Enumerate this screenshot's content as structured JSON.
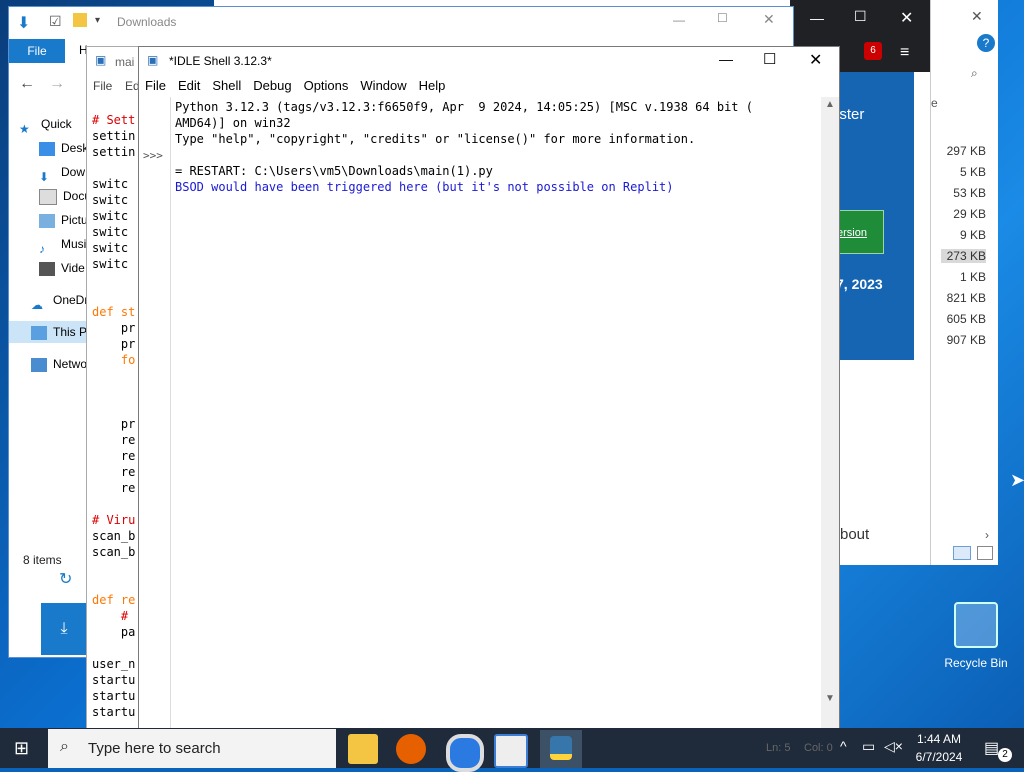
{
  "explorer": {
    "title": "Downloads",
    "file_tab": "File",
    "home_tab": "H",
    "edit_tab": "Ed",
    "nav": [
      {
        "label": "Quick"
      },
      {
        "label": "Desk"
      },
      {
        "label": "Dow"
      },
      {
        "label": "Docu"
      },
      {
        "label": "Pictu"
      },
      {
        "label": "Musi"
      },
      {
        "label": "Vide"
      },
      {
        "label": "OneDr"
      },
      {
        "label": "This P"
      },
      {
        "label": "Netwo"
      }
    ],
    "status": "8 items",
    "sizes": [
      "297 KB",
      "5 KB",
      "53 KB",
      "29 KB",
      "9 KB",
      "273 KB",
      "1 KB",
      "821 KB",
      "605 KB",
      "907 KB"
    ]
  },
  "editor": {
    "title": "mai",
    "menu": [
      "File",
      "Ed"
    ],
    "lines": [
      "# Sett",
      "settin",
      "settin",
      "",
      "switc",
      "switc",
      "switc",
      "switc",
      "switc",
      "switc",
      "",
      "",
      "def st",
      "    pr",
      "    pr",
      "    fo",
      "",
      "",
      "",
      "    pr",
      "    re",
      "    re",
      "    re",
      "    re",
      "",
      "# Viru",
      "scan_b",
      "scan_b",
      "",
      "",
      "def re",
      "    #",
      "    pa",
      "",
      "user_n",
      "startu",
      "startu",
      "startu"
    ],
    "status_line": "Ln: 5",
    "status_col": "Col: 0"
  },
  "browser": {
    "badge": "6",
    "link_text": "ister",
    "button_text": "ersion",
    "date_text": "7, 2023",
    "about_text": "bout",
    "right_char": "e"
  },
  "idle": {
    "title": "*IDLE Shell 3.12.3*",
    "menu": [
      "File",
      "Edit",
      "Shell",
      "Debug",
      "Options",
      "Window",
      "Help"
    ],
    "prompt": ">>>",
    "lines": [
      {
        "text": "Python 3.12.3 (tags/v3.12.3:f6650f9, Apr  9 2024, 14:05:25) [MSC v.1938 64 bit (",
        "color": "#000000"
      },
      {
        "text": "AMD64)] on win32",
        "color": "#000000"
      },
      {
        "text": "Type \"help\", \"copyright\", \"credits\" or \"license()\" for more information.",
        "color": "#000000"
      },
      {
        "text": "",
        "color": "#000000"
      },
      {
        "text": "= RESTART: C:\\Users\\vm5\\Downloads\\main(1).py",
        "color": "#000000"
      },
      {
        "text": "BSOD would have been triggered here (but it's not possible on Replit)",
        "color": "#1a1ad6"
      }
    ]
  },
  "desktop": {
    "recycle_bin": "Recycle Bin"
  },
  "taskbar": {
    "search_placeholder": "Type here to search",
    "time": "1:44 AM",
    "date": "6/7/2024",
    "notification_count": "2"
  },
  "colors": {
    "accent": "#1979ca",
    "taskbar": "#1f2b3a",
    "output_blue": "#1a1ad6",
    "editor_comment": "#dd0000",
    "editor_keyword": "#ff7700"
  }
}
